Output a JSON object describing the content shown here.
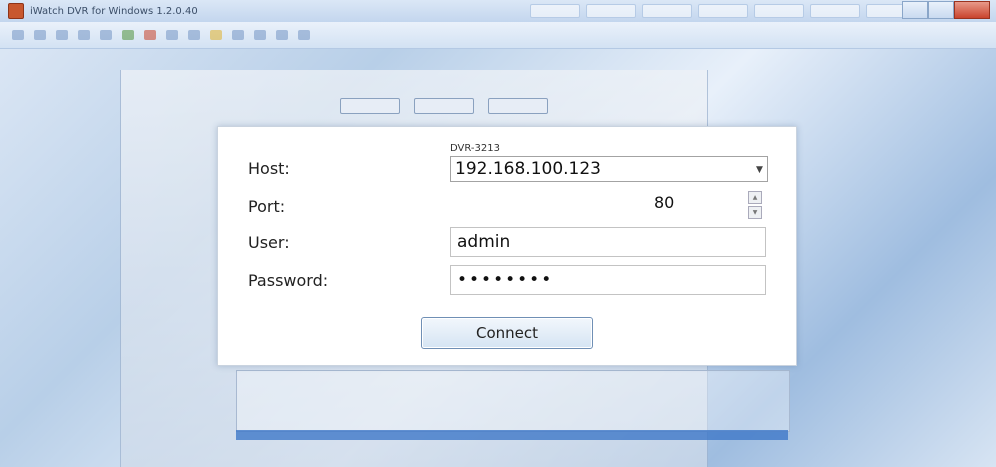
{
  "window": {
    "title": "iWatch DVR for Windows 1.2.0.40"
  },
  "dialog": {
    "device_name": "DVR-3213",
    "host": {
      "label": "Host:",
      "value": "192.168.100.123"
    },
    "port": {
      "label": "Port:",
      "value": "80"
    },
    "user": {
      "label": "User:",
      "value": "admin"
    },
    "password": {
      "label": "Password:",
      "value": "••••••••"
    },
    "connect_button": "Connect"
  }
}
